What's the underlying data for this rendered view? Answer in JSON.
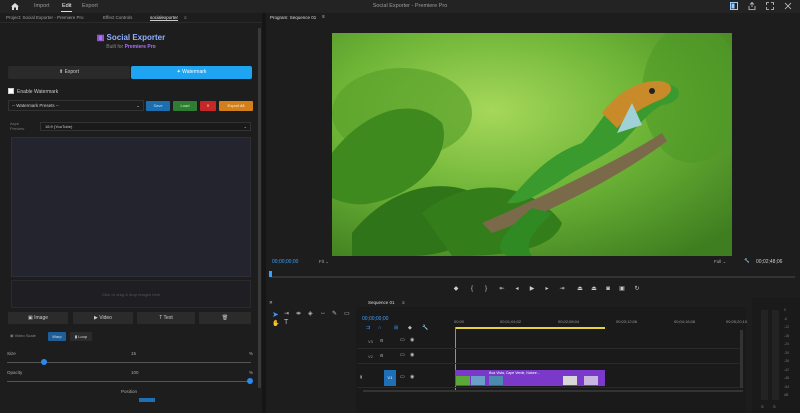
{
  "topbar": {
    "nav": [
      "Import",
      "Edit",
      "Export"
    ],
    "title": "Social Exporter - Premiere Pro"
  },
  "left_tabs": [
    "Project: Social Exporter - Premiere Pro",
    "Effect Controls",
    "socialexporter"
  ],
  "plugin": {
    "title": "Social Exporter",
    "subtitle_prefix": "Built for",
    "subtitle_brand": "Premiere Pro",
    "tabs": [
      "Export",
      "Watermark"
    ],
    "enable_label": "Enable Watermark",
    "preset_placeholder": "-- Watermark Presets --",
    "preset_buttons": [
      "Save",
      "Load",
      "✕",
      "Export All"
    ],
    "platform_label_1": "Aspe",
    "platform_label_2": "Preview",
    "platform_value": "16:9 (YouTube)",
    "dropzone_text": "Click or drag & drop images here",
    "type_buttons": [
      "Image",
      "Video",
      "Text",
      ""
    ],
    "anchor_label": "Video Scale",
    "mini_buttons": [
      "Warp",
      "Loop"
    ],
    "size_label": "Size",
    "size_value": "15",
    "size_unit": "%",
    "opacity_label": "Opacity",
    "opacity_value": "100",
    "opacity_unit": "%",
    "position_label": "Position"
  },
  "program": {
    "title": "Program: Sequence 01",
    "timecode": "00;00;00;00",
    "fit": "Fit",
    "full": "Full",
    "duration": "00;02;48;06"
  },
  "timeline": {
    "title": "Sequence 01",
    "timecode": "00;00;00;00",
    "ruler": [
      "00;00",
      "00;01;04;02",
      "00;02;08;04",
      "00;03;12;06",
      "00;04;16;08",
      "00;05;20;10"
    ],
    "tracks": [
      "V3",
      "V2",
      "V1"
    ],
    "clip_label": "Boa Vista, Cape Verde, Nature..."
  },
  "meter": {
    "labels": [
      "0",
      "-6",
      "-12",
      "-18",
      "-24",
      "-30",
      "-36",
      "-42",
      "-48",
      "-54",
      "dB"
    ],
    "footer": [
      "S",
      "S"
    ]
  },
  "colors": {
    "accent": "#1ea4f0",
    "save": "#1b6fb0",
    "load": "#2e7d32",
    "del": "#c62828",
    "export_all": "#d4801a",
    "clip": "#7a39c8",
    "playhead": "#4a9fff",
    "workarea": "#e6d43a"
  }
}
